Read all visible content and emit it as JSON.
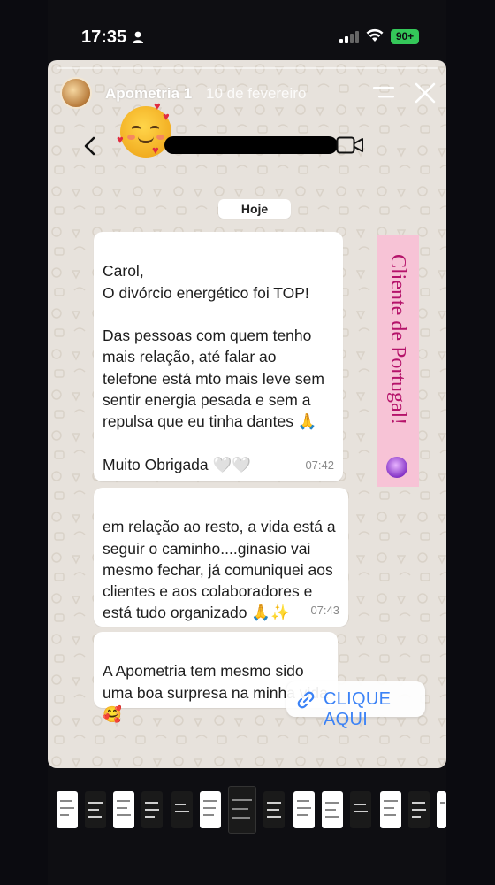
{
  "status_bar": {
    "time": "17:35",
    "battery": "90+",
    "battery_color": "#34c759"
  },
  "story": {
    "author": "Apometria 1",
    "date": "10 de fevereiro",
    "icons": [
      "avatar",
      "menu-icon",
      "close-icon"
    ]
  },
  "chat": {
    "date_chip": "Hoje",
    "messages": [
      {
        "text": "Carol,\nO divórcio energético foi TOP!\n\nDas pessoas com quem tenho mais relação, até falar ao telefone está mto mais leve sem sentir energia pesada e sem a repulsa que eu tinha dantes 🙏\n\nMuito Obrigada 🤍🤍",
        "time": "07:42"
      },
      {
        "text": "em relação ao resto, a vida está a seguir o caminho....ginasio vai mesmo fechar, já comuniquei aos clientes e aos colaboradores e está tudo organizado 🙏✨",
        "time": "07:43"
      },
      {
        "text": "A Apometria tem mesmo sido uma boa surpresa na minha vida 🥰",
        "time": ""
      }
    ]
  },
  "overlay": {
    "side_label": "Cliente de Portugal!",
    "side_label_color": "#b5136a",
    "side_label_bg": "#f7c3d6",
    "link_label": "CLIQUE AQUI",
    "link_color": "#3b82f6"
  }
}
